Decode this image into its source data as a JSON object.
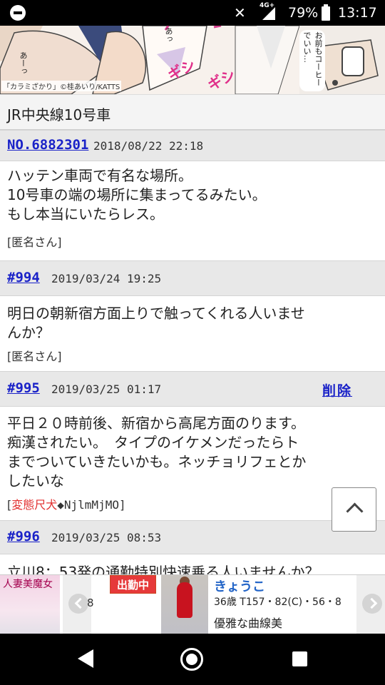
{
  "status_bar": {
    "network": "4G+",
    "battery": "79%",
    "time": "13:17"
  },
  "banner": {
    "credit": "「カラミざかり」©桂あいり/KATTS",
    "balloon_1": "あっ",
    "balloon_2": "あーっ",
    "balloon_3": "お前もコーヒーでいい…",
    "sfx_1": "ギシ",
    "sfx_2": "ギシ"
  },
  "thread": {
    "title": "JR中央線10号車"
  },
  "posts": [
    {
      "num": "NO.6882301",
      "date": "2018/08/22 22:18",
      "body_lines": [
        "ハッテン車両で有名な場所。",
        "10号車の端の場所に集まってるみたい。",
        "もし本当にいたらレス。"
      ],
      "author": "[匿名さん]"
    },
    {
      "num": "#994",
      "date": "2019/03/24 19:25",
      "body_lines": [
        "明日の朝新宿方面上りで触ってくれる人いませ",
        "んか？"
      ],
      "author": "[匿名さん]"
    },
    {
      "num": "#995",
      "date": "2019/03/25 01:17",
      "delete": "削除",
      "body_lines": [
        "平日２０時前後、新宿から高尾方面のります。",
        "痴漢されたい。　タイプのイケメンだったらト",
        "までついていきたいかも。ネッチョリフェとか",
        "したいな"
      ],
      "author_open": "[",
      "author_name": "変態尺犬",
      "author_trip": "◆NjlmMjMO]"
    },
    {
      "num": "#996",
      "date": "2019/03/25 08:53",
      "body_partial": "立川8：53発の通勤特別快速乗る人いませんか？"
    }
  ],
  "ad": {
    "logo_text": "人妻美魔女",
    "prev_fragment": "8",
    "status": "出勤中",
    "name": "きょうこ",
    "stats": "36歳 T157・82(C)・56・8",
    "desc": "優雅な曲線美"
  }
}
